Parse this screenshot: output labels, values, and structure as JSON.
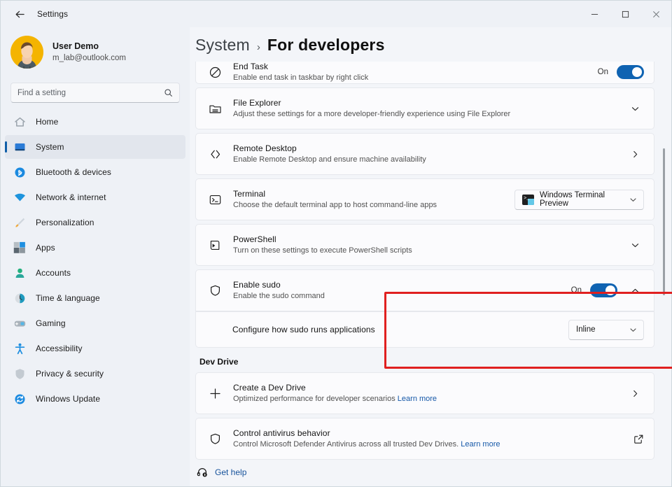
{
  "window": {
    "title": "Settings",
    "back_label": "back-arrow",
    "controls": {
      "minimize": "Minimize",
      "maximize": "Maximize",
      "close": "Close"
    }
  },
  "account": {
    "name": "User Demo",
    "email": "m_lab@outlook.com"
  },
  "search": {
    "placeholder": "Find a setting",
    "value": ""
  },
  "sidebar": {
    "items": [
      {
        "label": "Home",
        "icon": "home-icon",
        "active": false
      },
      {
        "label": "System",
        "icon": "system-icon",
        "active": true
      },
      {
        "label": "Bluetooth & devices",
        "icon": "bluetooth-icon",
        "active": false
      },
      {
        "label": "Network & internet",
        "icon": "wifi-icon",
        "active": false
      },
      {
        "label": "Personalization",
        "icon": "brush-icon",
        "active": false
      },
      {
        "label": "Apps",
        "icon": "apps-icon",
        "active": false
      },
      {
        "label": "Accounts",
        "icon": "account-icon",
        "active": false
      },
      {
        "label": "Time & language",
        "icon": "clock-icon",
        "active": false
      },
      {
        "label": "Gaming",
        "icon": "gamepad-icon",
        "active": false
      },
      {
        "label": "Accessibility",
        "icon": "accessibility-icon",
        "active": false
      },
      {
        "label": "Privacy & security",
        "icon": "shield-icon",
        "active": false
      },
      {
        "label": "Windows Update",
        "icon": "update-icon",
        "active": false
      }
    ]
  },
  "breadcrumb": {
    "root": "System",
    "separator": "›",
    "leaf": "For developers"
  },
  "settings": {
    "end_task": {
      "title": "End Task",
      "subtitle": "Enable end task in taskbar by right click",
      "state": "On"
    },
    "file_explorer": {
      "title": "File Explorer",
      "subtitle": "Adjust these settings for a more developer-friendly experience using File Explorer"
    },
    "remote_desktop": {
      "title": "Remote Desktop",
      "subtitle": "Enable Remote Desktop and ensure machine availability"
    },
    "terminal": {
      "title": "Terminal",
      "subtitle": "Choose the default terminal app to host command-line apps",
      "selected": "Windows Terminal Preview"
    },
    "powershell": {
      "title": "PowerShell",
      "subtitle": "Turn on these settings to execute PowerShell scripts"
    },
    "enable_sudo": {
      "title": "Enable sudo",
      "subtitle": "Enable the sudo command",
      "state": "On"
    },
    "sudo_mode": {
      "label": "Configure how sudo runs applications",
      "selected": "Inline"
    }
  },
  "dev_drive": {
    "heading": "Dev Drive",
    "create": {
      "title": "Create a Dev Drive",
      "subtitle": "Optimized performance for developer scenarios",
      "link": "Learn more"
    },
    "antivirus": {
      "title": "Control antivirus behavior",
      "subtitle": "Control Microsoft Defender Antivirus across all trusted Dev Drives.",
      "link": "Learn more"
    }
  },
  "footer": {
    "get_help": "Get help"
  },
  "colors": {
    "accent": "#0f63b2",
    "highlight": "#e02020",
    "link": "#1558a8"
  }
}
